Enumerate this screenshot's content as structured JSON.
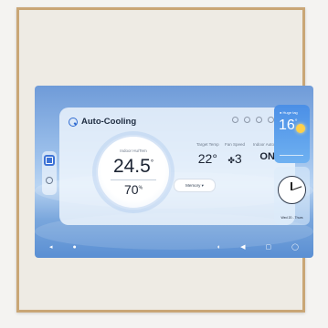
{
  "app": {
    "title": "Auto-Cooling"
  },
  "climate": {
    "indoor_label": "Indoor Hu/Tem",
    "indoor_temp": "24.5",
    "degree": "°",
    "humidity": "70",
    "humidity_unit": "%"
  },
  "controls": {
    "target_label": "Target Temp",
    "target_value": "22°",
    "fan_label": "Fan Speed",
    "fan_value": "3",
    "auto_label": "Indoor AutoRun",
    "auto_value": "ON",
    "memory_button": "Memory ▾"
  },
  "weather": {
    "location": "● Huge tag",
    "temp": "16",
    "degree": "°"
  },
  "clock": {
    "date": "Wed 20 - Thurs"
  },
  "nav": {
    "back": "◂",
    "home": "●",
    "media": "◖",
    "volume": "◀",
    "screen": "▢",
    "power": "◯"
  },
  "colors": {
    "accent": "#3d73d6",
    "frame": "#c9a676"
  }
}
